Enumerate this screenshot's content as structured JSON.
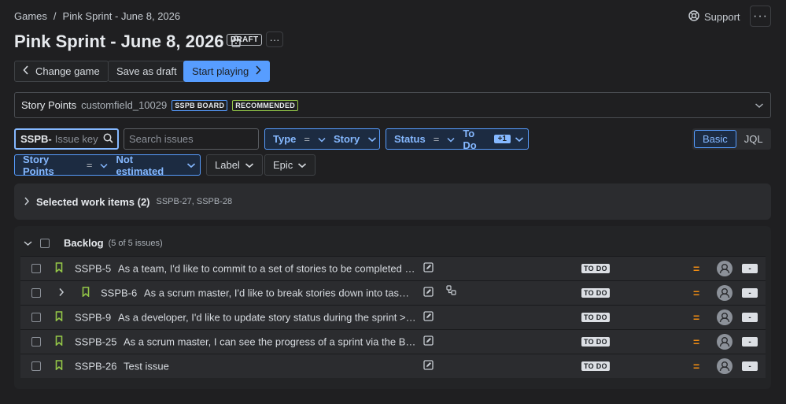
{
  "breadcrumb": {
    "root": "Games",
    "separator": "/",
    "current": "Pink Sprint - June 8, 2026"
  },
  "header": {
    "support_label": "Support",
    "more_label": "···"
  },
  "title": {
    "text": "Pink Sprint - June 8, 2026",
    "badge": "DRAFT",
    "more_label": "···"
  },
  "actions": {
    "change_game": "Change game",
    "save_draft": "Save as draft",
    "start_playing": "Start playing"
  },
  "field_selector": {
    "label": "Story Points",
    "field_id": "customfield_10029",
    "badge_board": "SSPB BOARD",
    "badge_recommended": "RECOMMENDED"
  },
  "filters": {
    "key_prefix": "SSPB-",
    "key_placeholder": "Issue key",
    "search_placeholder": "Search issues",
    "type": {
      "name": "Type",
      "op": "=",
      "value": "Story"
    },
    "status": {
      "name": "Status",
      "op": "=",
      "value": "To Do",
      "extra": "+1"
    },
    "points": {
      "name": "Story Points",
      "op": "=",
      "value": "Not estimated"
    },
    "label": "Label",
    "epic": "Epic"
  },
  "mode_toggle": {
    "basic": "Basic",
    "jql": "JQL"
  },
  "selected": {
    "label": "Selected work items (2)",
    "keys": "SSPB-27, SSPB-28"
  },
  "backlog": {
    "title": "Backlog",
    "count": "(5 of 5 issues)",
    "rows": [
      {
        "key": "SSPB-5",
        "summary": "As a team, I'd like to commit to a set of stories to be completed in a s...",
        "status": "TO DO",
        "points": "-"
      },
      {
        "key": "SSPB-6",
        "summary": "As a scrum master, I'd like to break stories down into tasks we ...",
        "status": "TO DO",
        "points": "-"
      },
      {
        "key": "SSPB-9",
        "summary": "As a developer, I'd like to update story status during the sprint >> Cli...",
        "status": "TO DO",
        "points": "-"
      },
      {
        "key": "SSPB-25",
        "summary": "As a scrum master, I can see the progress of a sprint via the Burndo...",
        "status": "TO DO",
        "points": "-"
      },
      {
        "key": "SSPB-26",
        "summary": "Test issue",
        "status": "TO DO",
        "points": "-"
      }
    ]
  },
  "colors": {
    "accent": "#579dff",
    "story_icon": "#94c748",
    "priority": "#f18d13",
    "background": "#1f1f21"
  },
  "icons": {
    "support": "lifebuoy-icon",
    "lock": "lock-icon",
    "story": "bookmark-icon",
    "edit": "edit-icon",
    "subtasks": "subtask-icon",
    "priority": "priority-medium-icon"
  }
}
